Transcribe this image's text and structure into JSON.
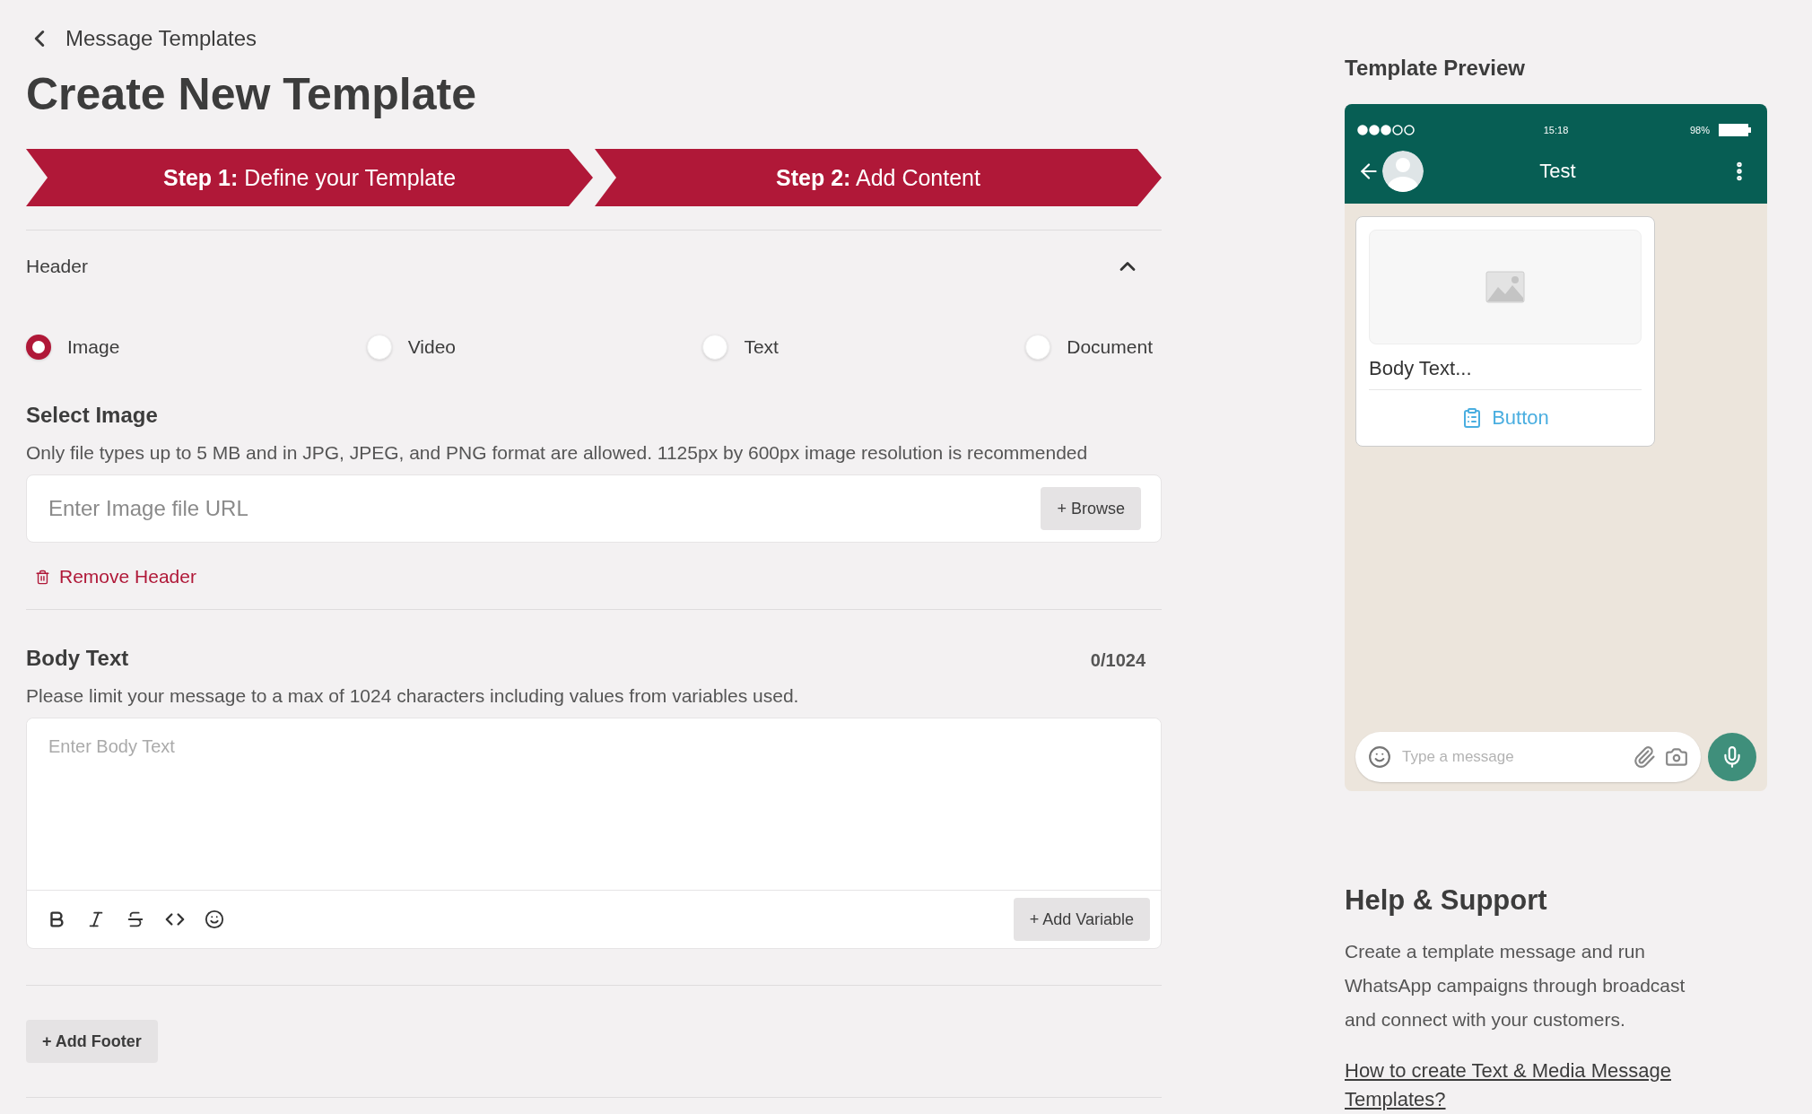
{
  "breadcrumb": {
    "label": "Message Templates"
  },
  "title": "Create New Template",
  "steps": [
    {
      "label": "**Step 1:** Define your Template"
    },
    {
      "label": "**Step 2:** Add Content"
    }
  ],
  "header_section": {
    "title": "Header",
    "expanded": true,
    "types": [
      {
        "label": "Image",
        "selected": true
      },
      {
        "label": "Video",
        "selected": false
      },
      {
        "label": "Text",
        "selected": false
      },
      {
        "label": "Document",
        "selected": false
      }
    ],
    "select_image": {
      "title": "Select Image",
      "hint": "Only file types up to 5 MB and in JPG, JPEG, and PNG format are allowed. 1125px by 600px image resolution is recommended",
      "field": {
        "placeholder": "Enter Image file URL"
      },
      "browse_button": "+ Browse"
    },
    "remove_button": "Remove Header"
  },
  "body_text": {
    "title": "Body Text",
    "counter": "0/1024",
    "hint": "Please limit your message to a max of 1024 characters including values from variables used.",
    "field": {
      "placeholder": "Enter Body Text"
    },
    "add_variable": "+ Add Variable"
  },
  "add_footer": "+ Add Footer",
  "preview": {
    "title": "Template Preview",
    "time": "15:18",
    "battery": "98%",
    "contact": "Test",
    "body": "Body Text...",
    "button": "Button",
    "composer": {
      "placeholder": "Type a message"
    }
  },
  "help": {
    "title": "Help & Support",
    "text": "Create a template message and run WhatsApp campaigns through broadcast and connect with your customers.",
    "link": "How to create Text & Media Message Templates?"
  }
}
